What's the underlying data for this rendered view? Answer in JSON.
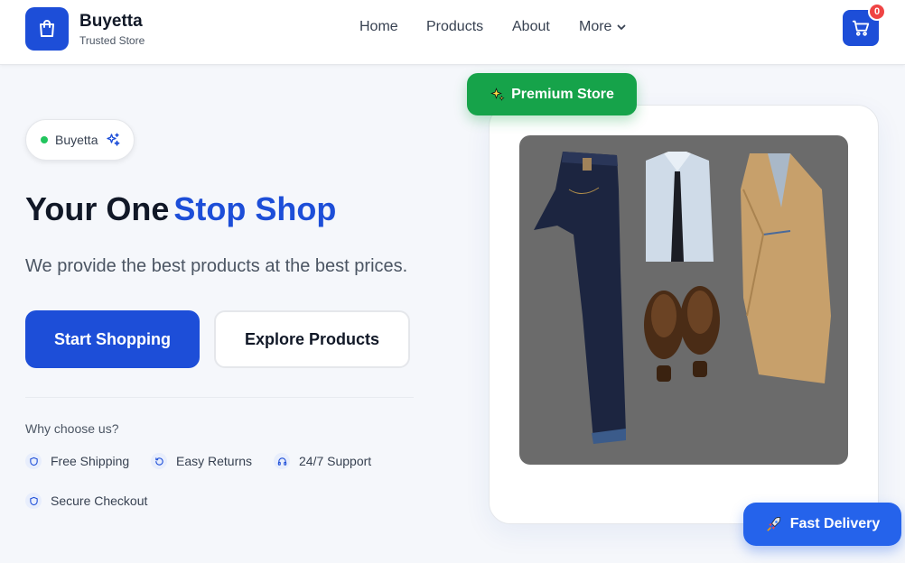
{
  "brand": {
    "name": "Buyetta",
    "tagline": "Trusted Store"
  },
  "nav": {
    "items": [
      "Home",
      "Products",
      "About"
    ],
    "more_label": "More"
  },
  "cart": {
    "count": "0"
  },
  "hero": {
    "pill_label": "Buyetta",
    "headline_main": "Your One",
    "headline_accent": "Stop Shop",
    "subhead": "We provide the best products at the best prices.",
    "primary_button": "Start Shopping",
    "secondary_button": "Explore Products",
    "why_title": "Why choose us?",
    "features": [
      "Free Shipping",
      "Easy Returns",
      "24/7 Support",
      "Secure Checkout"
    ]
  },
  "badges": {
    "premium": "Premium Store",
    "delivery": "Fast Delivery"
  },
  "colors": {
    "primary": "#1d4ed8",
    "success": "#16a34a",
    "danger": "#ef4444"
  },
  "icons": [
    "shopping-bag-icon",
    "cart-icon",
    "chevron-down-icon",
    "sparkles-icon",
    "shield-icon",
    "refresh-icon",
    "headphones-icon",
    "rocket-icon"
  ]
}
